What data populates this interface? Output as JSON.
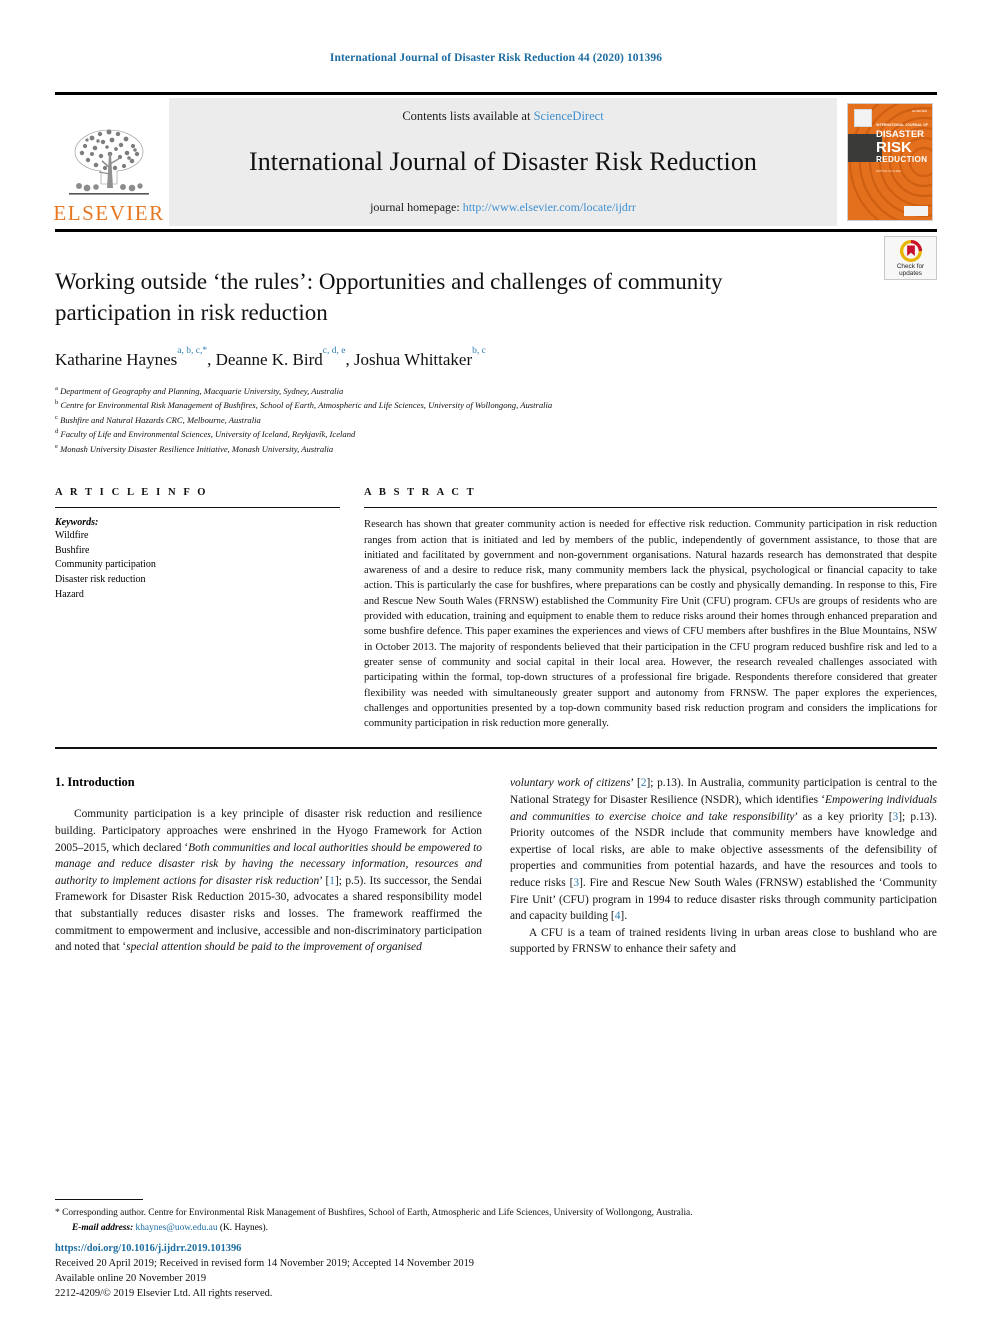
{
  "running_head": "International Journal of Disaster Risk Reduction 44 (2020) 101396",
  "masthead": {
    "publisher_logo_text": "ELSEVIER",
    "contents_prefix": "Contents lists available at",
    "contents_link": "ScienceDirect",
    "journal_title": "International Journal of Disaster Risk Reduction",
    "homepage_prefix": "journal homepage:",
    "homepage_url": "http://www.elsevier.com/locate/ijdrr",
    "cover": {
      "pre_title": "INTERNATIONAL JOURNAL OF",
      "line1": "DISASTER",
      "line2": "RISK",
      "line3": "REDUCTION",
      "subtitle": "EDITOR-IN-CHIEF",
      "corner_label": "ELSEVIER"
    }
  },
  "crossmark": {
    "line1": "Check for",
    "line2": "updates"
  },
  "article": {
    "title": "Working outside ‘the rules’: Opportunities and challenges of community participation in risk reduction",
    "authors": [
      {
        "name": "Katharine Haynes",
        "sup": "a, b, c,",
        "star": "*"
      },
      {
        "name": "Deanne K. Bird",
        "sup": "c, d, e",
        "star": ""
      },
      {
        "name": "Joshua Whittaker",
        "sup": "b, c",
        "star": ""
      }
    ],
    "affiliations": [
      {
        "mark": "a",
        "text": "Department of Geography and Planning, Macquarie University, Sydney, Australia"
      },
      {
        "mark": "b",
        "text": "Centre for Environmental Risk Management of Bushfires, School of Earth, Atmospheric and Life Sciences, University of Wollongong, Australia"
      },
      {
        "mark": "c",
        "text": "Bushfire and Natural Hazards CRC, Melbourne, Australia"
      },
      {
        "mark": "d",
        "text": "Faculty of Life and Environmental Sciences, University of Iceland, Reykjavík, Iceland"
      },
      {
        "mark": "e",
        "text": "Monash University Disaster Resilience Initiative, Monash University, Australia"
      }
    ]
  },
  "article_info": {
    "heading": "A R T I C L E   I N F O",
    "keywords_label": "Keywords:",
    "keywords": [
      "Wildfire",
      "Bushfire",
      "Community participation",
      "Disaster risk reduction",
      "Hazard"
    ]
  },
  "abstract": {
    "heading": "A B S T R A C T",
    "text": "Research has shown that greater community action is needed for effective risk reduction. Community participation in risk reduction ranges from action that is initiated and led by members of the public, independently of government assistance, to those that are initiated and facilitated by government and non-government organisations. Natural hazards research has demonstrated that despite awareness of and a desire to reduce risk, many community members lack the physical, psychological or financial capacity to take action. This is particularly the case for bushfires, where preparations can be costly and physically demanding. In response to this, Fire and Rescue New South Wales (FRNSW) established the Community Fire Unit (CFU) program. CFUs are groups of residents who are provided with education, training and equipment to enable them to reduce risks around their homes through enhanced preparation and some bushfire defence. This paper examines the experiences and views of CFU members after bushfires in the Blue Mountains, NSW in October 2013. The majority of respondents believed that their participation in the CFU program reduced bushfire risk and led to a greater sense of community and social capital in their local area. However, the research revealed challenges associated with participating within the formal, top-down structures of a professional fire brigade. Respondents therefore considered that greater flexibility was needed with simultaneously greater support and autonomy from FRNSW. The paper explores the experiences, challenges and opportunities presented by a top-down community based risk reduction program and considers the implications for community participation in risk reduction more generally."
  },
  "body": {
    "section_number_title": "1.  Introduction",
    "left_paragraph_1_a": "Community participation is a key principle of disaster risk reduction and resilience building. Participatory approaches were enshrined in the Hyogo Framework for Action 2005–2015, which declared ‘",
    "left_paragraph_1_italic_1": "Both communities and local authorities should be empowered to manage and reduce disaster risk by having the necessary information, resources and authority to implement actions for disaster risk reduction",
    "left_paragraph_1_b": "’ [",
    "left_ref_1": "1",
    "left_paragraph_1_c": "]; p.5). Its successor, the Sendai Framework for Disaster Risk Reduction 2015-30, advocates a shared responsibility model that substantially reduces disaster risks and losses. The framework reaffirmed the commitment to empowerment and inclusive, accessible and non-discriminatory participation and noted that ‘",
    "left_paragraph_1_italic_2": "special attention should be paid to the improvement of organised",
    "right_paragraph_1_italic_0": "voluntary work of citizens",
    "right_paragraph_1_a": "’ [",
    "right_ref_2": "2",
    "right_paragraph_1_b": "]; p.13). In Australia, community participation is central to the National Strategy for Disaster Resilience (NSDR), which identifies ‘",
    "right_paragraph_1_italic_1": "Empowering individuals and communities to exercise choice and take responsibility",
    "right_paragraph_1_c": "’ as a key priority [",
    "right_ref_3": "3",
    "right_paragraph_1_d": "]; p.13). Priority outcomes of the NSDR include that community members have knowledge and expertise of local risks, are able to make objective assessments of the defensibility of properties and communities from potential hazards, and have the resources and tools to reduce risks [",
    "right_ref_3b": "3",
    "right_paragraph_1_e": "]. Fire and Rescue New South Wales (FRNSW) established the ‘Community Fire Unit’ (CFU) program in 1994 to reduce disaster risks through community participation and capacity building [",
    "right_ref_4": "4",
    "right_paragraph_1_f": "].",
    "right_paragraph_2": "A CFU is a team of trained residents living in urban areas close to bushland who are supported by FRNSW to enhance their safety and"
  },
  "footnotes": {
    "corresponding_star": "*",
    "corresponding_text": "Corresponding author. Centre for Environmental Risk Management of Bushfires, School of Earth, Atmospheric and Life Sciences, University of Wollongong, Australia.",
    "email_label": "E-mail address:",
    "email_value": "khaynes@uow.edu.au",
    "email_suffix": "(K. Haynes)."
  },
  "imprint": {
    "doi": "https://doi.org/10.1016/j.ijdrr.2019.101396",
    "history": "Received 20 April 2019; Received in revised form 14 November 2019; Accepted 14 November 2019",
    "available": "Available online 20 November 2019",
    "copyright": "2212-4209/© 2019 Elsevier Ltd. All rights reserved."
  },
  "colors": {
    "link_blue": "#1c6ca1",
    "science_direct_blue": "#3f8fd0",
    "elsevier_orange": "#E87722",
    "cover_orange": "#E4701E",
    "masthead_gray": "#ececec"
  }
}
